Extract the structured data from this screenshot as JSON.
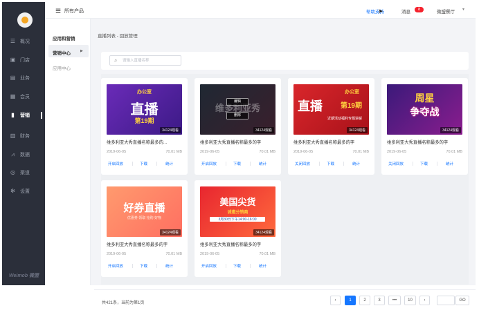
{
  "sidebar": {
    "items": [
      {
        "label": "概况",
        "icon": "dashboard-icon"
      },
      {
        "label": "门店",
        "icon": "store-icon"
      },
      {
        "label": "业务",
        "icon": "business-icon"
      },
      {
        "label": "会员",
        "icon": "member-icon"
      },
      {
        "label": "营销",
        "icon": "marketing-icon",
        "active": true
      },
      {
        "label": "财务",
        "icon": "finance-icon"
      },
      {
        "label": "数据",
        "icon": "data-icon"
      },
      {
        "label": "渠道",
        "icon": "channel-icon"
      },
      {
        "label": "设置",
        "icon": "settings-icon"
      }
    ],
    "brand": "Weimob 微盟"
  },
  "topbar": {
    "menu_label": "所有产品",
    "help": "帮助支持",
    "messages": "消息",
    "messages_count": "8",
    "store_name": "微盟餐厅"
  },
  "subnav": {
    "section": "应用和营销",
    "active": "营销中心",
    "app_center": "应用中心"
  },
  "breadcrumb": "直播列表 - 回放管理",
  "search": {
    "placeholder": "请输入直播名称"
  },
  "cards": [
    {
      "title": "维多利亚大秀直播名称最多的...",
      "date": "2019-06-05",
      "size": "70.01 MB",
      "count": "34124观看",
      "action1": "开启回放",
      "action2": "下载",
      "action3": "统计",
      "big": "直播",
      "sub": "第19期",
      "top": "办公室"
    },
    {
      "title": "维多利亚大秀直播名称最多的字",
      "date": "2019-06-05",
      "size": "70.01 MB",
      "count": "34124观看",
      "action1": "开启回放",
      "action2": "下载",
      "action3": "统计",
      "big": "维多利亚秀",
      "edit": "编辑",
      "delete": "删除"
    },
    {
      "title": "维多利亚大秀直播名称最多的字",
      "date": "2019-06-05",
      "size": "70.01 MB",
      "count": "34124观看",
      "action1": "关闭回放",
      "action2": "下载",
      "action3": "统计",
      "big": "直播",
      "sub": "第19期",
      "top": "办公室",
      "note": "近期活动福利专题讲解"
    },
    {
      "title": "维多利亚大秀直播名称最多的字",
      "date": "2019-06-05",
      "size": "70.01 MB",
      "count": "34124观看",
      "action1": "关闭回放",
      "action2": "下载",
      "action3": "统计",
      "big": "周星",
      "sub": "争夺战"
    },
    {
      "title": "维多利亚大秀直播名称最多的字",
      "date": "2019-06-05",
      "size": "70.01 MB",
      "count": "34124观看",
      "action1": "开启回放",
      "action2": "下载",
      "action3": "统计",
      "big": "好券直播",
      "note": "优惠券 领取 抢购 好物"
    },
    {
      "title": "维多利亚大秀直播名称最多的字",
      "date": "2019-06-05",
      "size": "70.01 MB",
      "count": "34124观看",
      "action1": "开启回放",
      "action2": "下载",
      "action3": "统计",
      "big": "美国尖货",
      "sub": "诚邀分销商",
      "note": "3月30日下午14:00-16:00"
    }
  ],
  "pagination": {
    "total": "共421条，当前为第1页",
    "pages": [
      "1",
      "2",
      "3",
      "•••",
      "10"
    ],
    "prev": "‹",
    "next": "›",
    "go": "GO"
  },
  "colors": {
    "accent": "#1677ff",
    "sidebar_bg": "#2b2f3a",
    "badge": "#f5222d"
  }
}
